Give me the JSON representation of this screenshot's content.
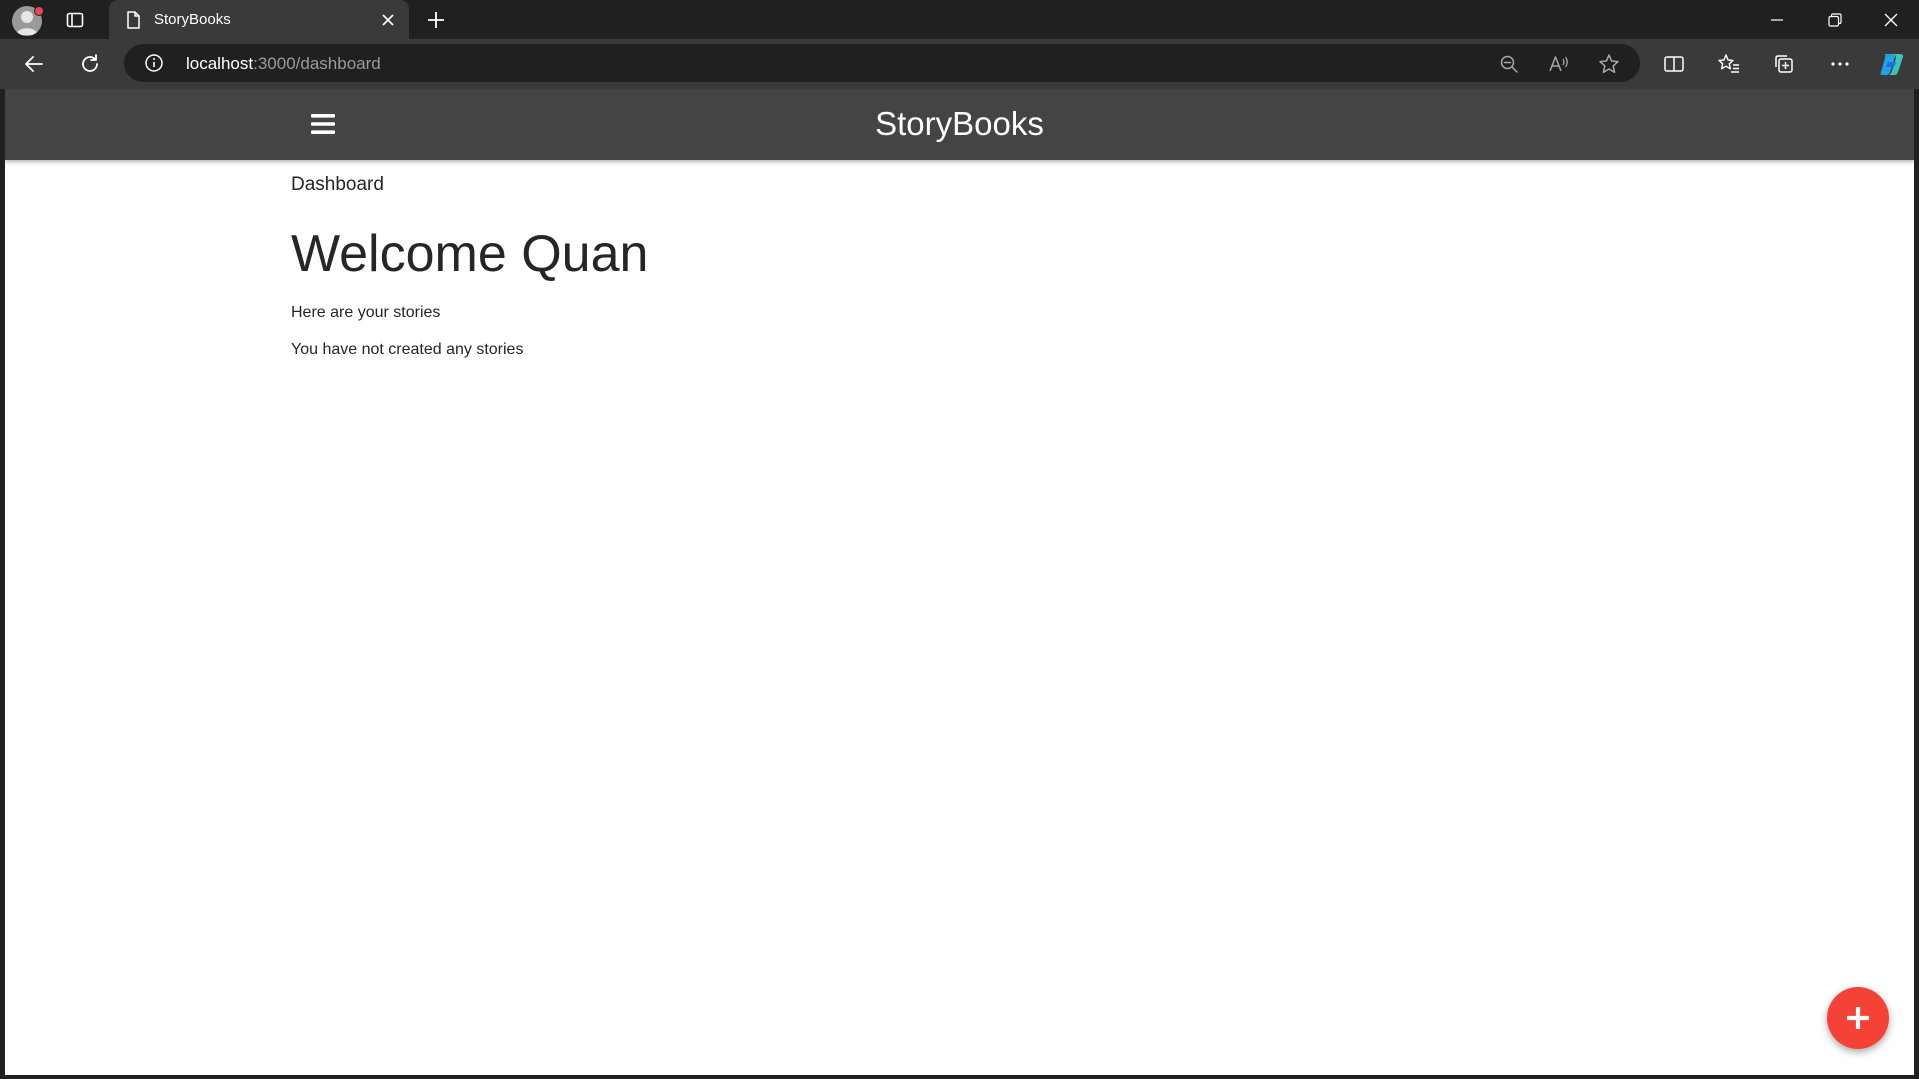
{
  "browser": {
    "tab": {
      "title": "StoryBooks"
    },
    "address": {
      "host": "localhost",
      "rest": ":3000/dashboard"
    }
  },
  "icons": {
    "profile": "profile-avatar-icon",
    "vertical_tabs": "vertical-tabs-icon",
    "page": "page-icon",
    "close": "close-icon",
    "new_tab": "plus-icon",
    "back": "back-arrow-icon",
    "reload": "reload-icon",
    "info": "info-icon",
    "zoom": "zoom-out-icon",
    "read_aloud": "read-aloud-icon",
    "favorite": "star-icon",
    "split": "split-screen-icon",
    "favorites": "favorites-list-icon",
    "collections": "collections-icon",
    "more": "more-icon",
    "copilot": "copilot-icon",
    "menu": "hamburger-menu-icon",
    "add": "plus-icon"
  },
  "navbar": {
    "brand": "StoryBooks"
  },
  "main": {
    "breadcrumb": "Dashboard",
    "heading": "Welcome Quan",
    "subtitle": "Here are your stories",
    "empty_message": "You have not created any stories"
  },
  "colors": {
    "navbar_bg": "#444444",
    "fab_bg": "#f44336",
    "text": "#262626",
    "browser_frame": "#202020",
    "browser_toolbar": "#3a3a3a"
  }
}
